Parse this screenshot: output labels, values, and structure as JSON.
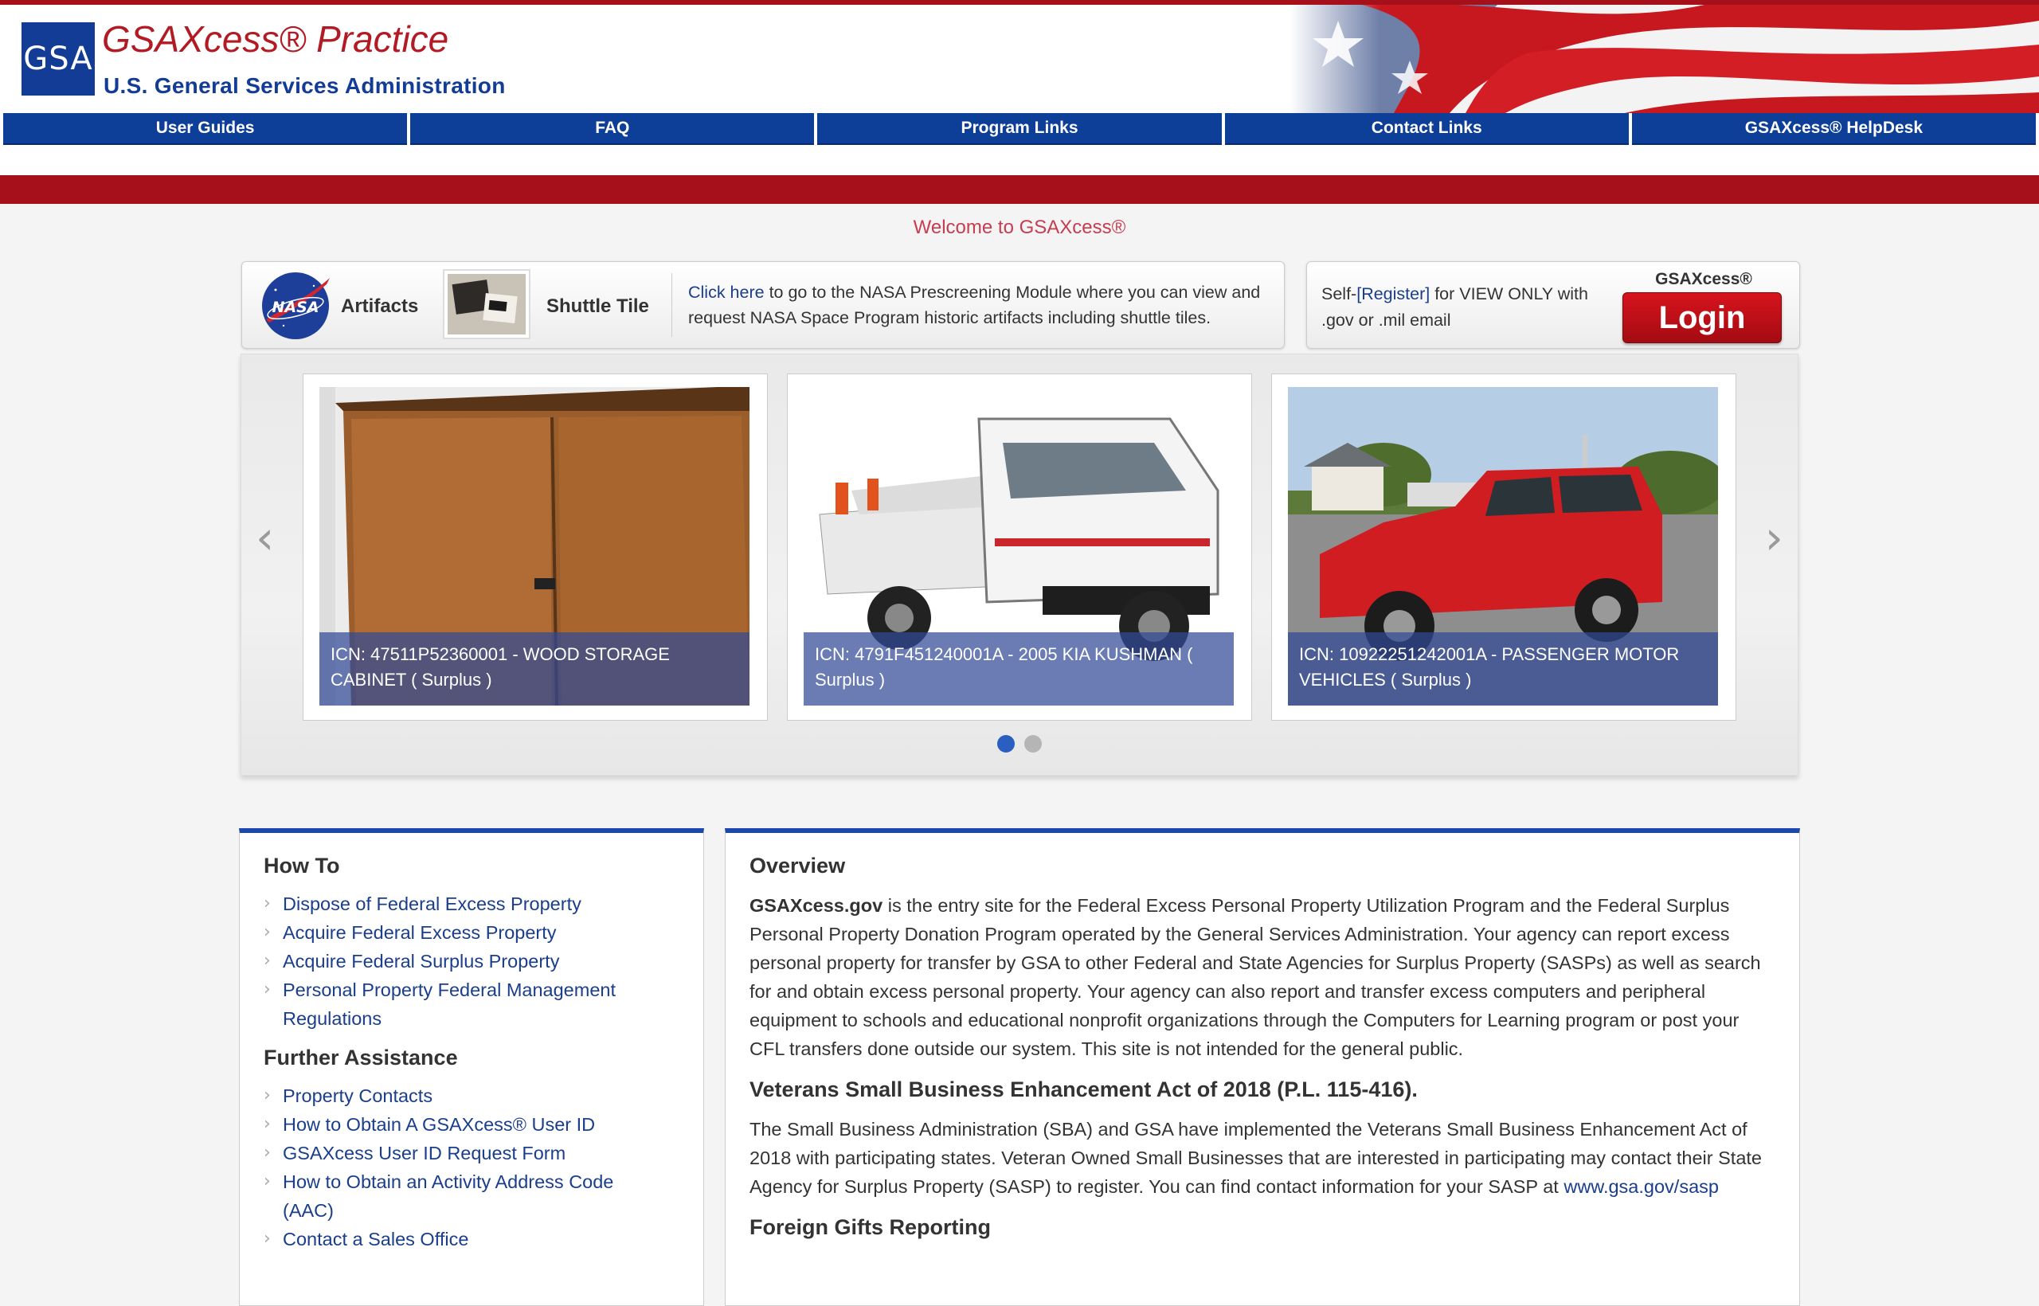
{
  "header": {
    "logo_text": "GSA",
    "title": "GSAXcess® Practice",
    "subtitle": "U.S. General Services Administration"
  },
  "nav": {
    "items": [
      {
        "label": "User Guides"
      },
      {
        "label": "FAQ"
      },
      {
        "label": "Program Links"
      },
      {
        "label": "Contact Links"
      },
      {
        "label": "GSAXcess® HelpDesk"
      }
    ]
  },
  "welcome": "Welcome to GSAXcess®",
  "nasa": {
    "logo_text": "NASA",
    "artifacts_label": "Artifacts",
    "shuttle_label": "Shuttle Tile",
    "link_text": "Click here",
    "description": " to go to the NASA Prescreening Module where you can view and request NASA Space Program historic artifacts including shuttle tiles."
  },
  "login": {
    "self_prefix": "Self-",
    "register_link": "[Register]",
    "register_suffix": " for VIEW ONLY with .gov or .mil email",
    "caption": "GSAXcess®",
    "button_label": "Login"
  },
  "carousel": {
    "prev_icon": "‹",
    "next_icon": "›",
    "slides": [
      {
        "caption": "ICN: 47511P52360001 - WOOD STORAGE CABINET ( Surplus )"
      },
      {
        "caption": "ICN: 4791F451240001A - 2005 KIA KUSHMAN ( Surplus )"
      },
      {
        "caption": "ICN: 10922251242001A - PASSENGER MOTOR VEHICLES ( Surplus )"
      }
    ],
    "dots": 2,
    "active_dot": 0
  },
  "howto": {
    "title": "How To",
    "links": [
      "Dispose of Federal Excess Property",
      "Acquire Federal Excess Property",
      "Acquire Federal Surplus Property",
      "Personal Property Federal Management Regulations"
    ],
    "further_title": "Further Assistance",
    "further_links": [
      "Property Contacts",
      "How to Obtain A GSAXcess® User ID",
      "GSAXcess User ID Request Form",
      "How to Obtain an Activity Address Code (AAC)",
      "Contact a Sales Office"
    ]
  },
  "overview": {
    "title": "Overview",
    "site_name": "GSAXcess.gov",
    "body": " is the entry site for the Federal Excess Personal Property Utilization Program and the Federal Surplus Personal Property Donation Program operated by the General Services Administration. Your agency can report excess personal property for transfer by GSA to other Federal and State Agencies for Surplus Property (SASPs) as well as search for and obtain excess personal property. Your agency can also report and transfer excess computers and peripheral equipment to schools and educational nonprofit organizations through the Computers for Learning program or post your CFL transfers done outside our system. This site is not intended for the general public.",
    "veterans_title": "Veterans Small Business Enhancement Act of 2018 (P.L. 115-416).",
    "veterans_body": "The Small Business Administration (SBA) and GSA have implemented the Veterans Small Business Enhancement Act of 2018 with participating states. Veteran Owned Small Businesses that are interested in participating may contact their State Agency for Surplus Property (SASP) to register. You can find contact information for your SASP at ",
    "veterans_link": "www.gsa.gov/sasp",
    "foreign_title": "Foreign Gifts Reporting"
  },
  "colors": {
    "brand_red": "#a5101b",
    "nav_blue": "#0d3f99",
    "link_blue": "#1a3e8c",
    "panel_accent": "#1a48ad"
  }
}
